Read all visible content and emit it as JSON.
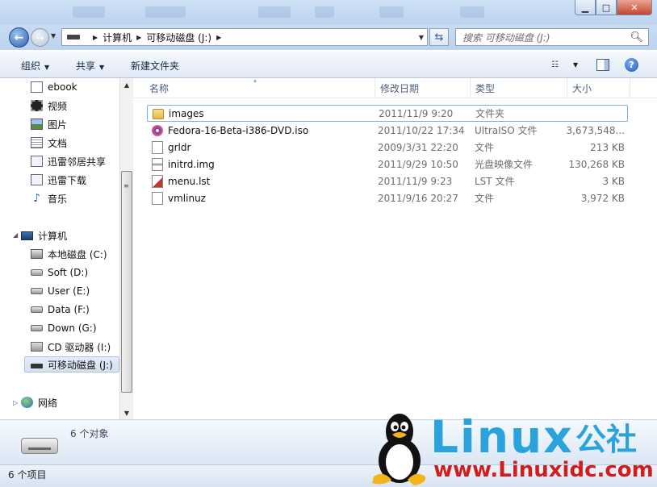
{
  "window": {
    "minimize_glyph": "▁",
    "maximize_glyph": "□",
    "close_glyph": "✕"
  },
  "address_bar": {
    "crumbs": [
      "计算机",
      "可移动磁盘 (J:)"
    ],
    "search_placeholder": "搜索 可移动磁盘 (J:)"
  },
  "toolbar": {
    "organize_label": "组织",
    "share_label": "共享",
    "new_folder_label": "新建文件夹"
  },
  "nav_pane": {
    "favorites": [
      {
        "label": "ebook",
        "icon": "document-icon"
      },
      {
        "label": "视频",
        "icon": "video-icon"
      },
      {
        "label": "图片",
        "icon": "picture-icon"
      },
      {
        "label": "文档",
        "icon": "document-text-icon"
      },
      {
        "label": "迅雷邻居共享",
        "icon": "thunder-share-icon"
      },
      {
        "label": "迅雷下载",
        "icon": "thunder-download-icon"
      },
      {
        "label": "音乐",
        "icon": "music-icon"
      }
    ],
    "computer_label": "计算机",
    "drives": [
      {
        "label": "本地磁盘 (C:)",
        "icon": "system-drive-icon"
      },
      {
        "label": "Soft (D:)",
        "icon": "hard-drive-icon"
      },
      {
        "label": "User (E:)",
        "icon": "hard-drive-icon"
      },
      {
        "label": "Data (F:)",
        "icon": "hard-drive-icon"
      },
      {
        "label": "Down (G:)",
        "icon": "hard-drive-icon"
      },
      {
        "label": "CD 驱动器 (I:)",
        "icon": "cd-drive-icon"
      },
      {
        "label": "可移动磁盘 (J:)",
        "icon": "usb-drive-icon"
      }
    ],
    "network_label": "网络"
  },
  "file_list": {
    "columns": [
      "名称",
      "修改日期",
      "类型",
      "大小"
    ],
    "files": [
      {
        "name": "images",
        "date": "2011/11/9 9:20",
        "type": "文件夹",
        "size": "",
        "icon": "folder-icon"
      },
      {
        "name": "Fedora-16-Beta-i386-DVD.iso",
        "date": "2011/10/22 17:34",
        "type": "UltraISO 文件",
        "size": "3,673,548...",
        "icon": "iso-file-icon"
      },
      {
        "name": "grldr",
        "date": "2009/3/31 22:20",
        "type": "文件",
        "size": "213 KB",
        "icon": "file-icon"
      },
      {
        "name": "initrd.img",
        "date": "2011/9/29 10:50",
        "type": "光盘映像文件",
        "size": "130,268 KB",
        "icon": "disc-image-icon"
      },
      {
        "name": "menu.lst",
        "date": "2011/11/9 9:23",
        "type": "LST 文件",
        "size": "3 KB",
        "icon": "lst-file-icon"
      },
      {
        "name": "vmlinuz",
        "date": "2011/9/16 20:27",
        "type": "文件",
        "size": "3,972 KB",
        "icon": "file-icon"
      }
    ]
  },
  "details_pane": {
    "object_count": "6 个对象"
  },
  "status_bar": {
    "item_count": "6 个项目"
  },
  "watermark": {
    "brand": "Linux",
    "brand_suffix": "公社",
    "url": "www.Linuxidc.com",
    "brand_color": "#2aa2dc",
    "url_color": "#d01e1e"
  }
}
